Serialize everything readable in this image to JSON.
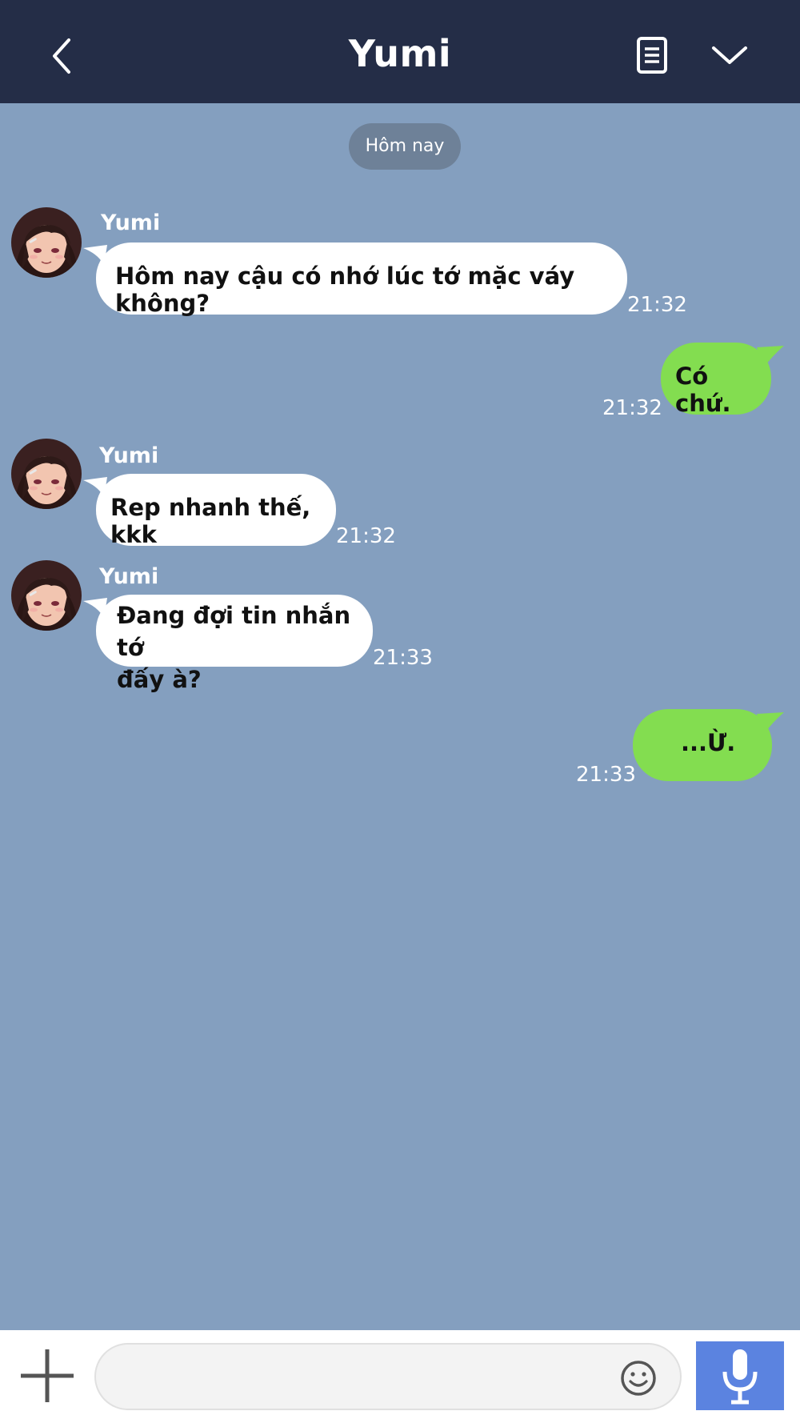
{
  "header": {
    "title": "Yumi",
    "back_icon": "chevron-left-icon",
    "notes_icon": "notes-icon",
    "menu_icon": "chevron-down-icon"
  },
  "date_divider": "Hôm nay",
  "messages": [
    {
      "direction": "incoming",
      "sender": "Yumi",
      "text": "Hôm nay cậu có nhớ lúc tớ mặc váy không?",
      "time": "21:32"
    },
    {
      "direction": "outgoing",
      "text": "Có chứ.",
      "time": "21:32"
    },
    {
      "direction": "incoming",
      "sender": "Yumi",
      "text": "Rep nhanh thế, kkk",
      "time": "21:32"
    },
    {
      "direction": "incoming",
      "sender": "Yumi",
      "lines": [
        "Đang đợi tin nhắn tớ",
        "đấy à?"
      ],
      "time": "21:33"
    },
    {
      "direction": "outgoing",
      "text": "...Ừ.",
      "time": "21:33"
    }
  ],
  "composer": {
    "value": "",
    "placeholder": "",
    "plus_icon": "plus-icon",
    "emoji_icon": "emoji-icon",
    "mic_icon": "microphone-icon"
  },
  "colors": {
    "header_bg": "#242d47",
    "chat_bg": "#849fbf",
    "incoming_bubble": "#ffffff",
    "outgoing_bubble": "#83dd50",
    "mic_button": "#5b83e0"
  }
}
